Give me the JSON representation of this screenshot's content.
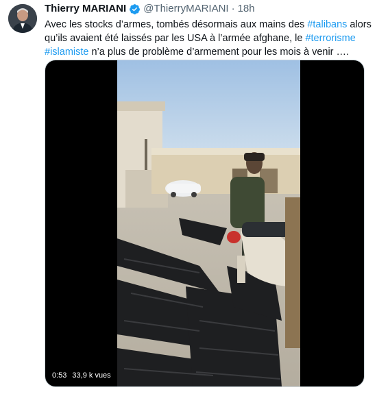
{
  "tweet": {
    "author_name": "Thierry MARIANI",
    "handle": "@ThierryMARIANI",
    "separator": "·",
    "time": "18h",
    "verified_icon": "verified-badge-icon",
    "text_part_1": "Avec les stocks d’armes, tombés désormais aux mains des ",
    "hashtag_1": "#talibans",
    "text_part_2": " alors",
    "text_part_3": "qu’ils avaient été laissés par les USA à l’armée afghane, le ",
    "hashtag_2": "#terrorisme",
    "hashtag_3": "#islamiste",
    "text_part_4": " n’a plus de problème d’armement pour les mois à venir ….",
    "colors": {
      "link": "#1d9bf0",
      "text": "#0f1419",
      "muted": "#536471"
    }
  },
  "video": {
    "duration": "0:53",
    "views": "33,9 k vues"
  }
}
